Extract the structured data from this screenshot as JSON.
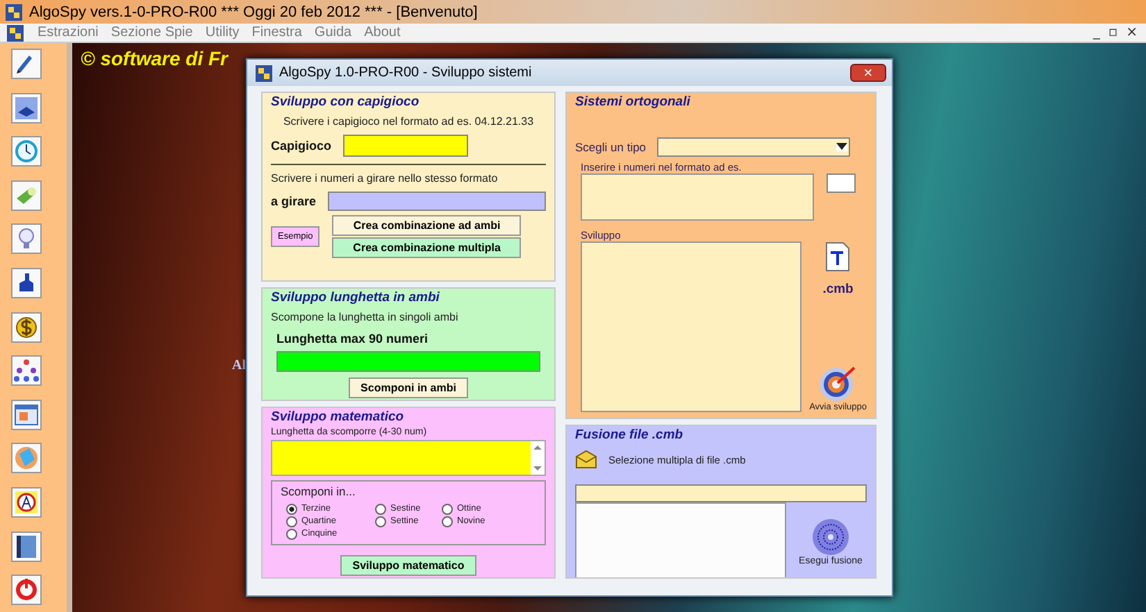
{
  "app_title": "AlgoSpy vers.1-0-PRO-R00  ***  Oggi 20 feb 2012  ***   - [Benvenuto]",
  "menu": [
    "Estrazioni",
    "Sezione Spie",
    "Utility",
    "Finestra",
    "Guida",
    "About"
  ],
  "mdi_controls": [
    "_",
    "▫",
    "×"
  ],
  "background_text": "© software di Fr",
  "background_logo_text": "Al",
  "dialog": {
    "title": "AlgoSpy 1.0-PRO-R00 - Sviluppo sistemi",
    "close": "×",
    "capigioco": {
      "legend": "Sviluppo con capigioco",
      "hint": "Scrivere i capigioco nel formato ad es. 04.12.21.33",
      "field_label": "Capigioco",
      "hint2": "Scrivere i numeri a girare nello stesso formato",
      "field2_label": "a girare",
      "example_button": "Esempio",
      "buttons": [
        "Crea combinazione ad ambi",
        "Crea combinazione multipla"
      ]
    },
    "lunghetta": {
      "legend": "Sviluppo lunghetta in ambi",
      "hint": "Scompone la lunghetta in singoli ambi",
      "field_label": "Lunghetta max 90 numeri",
      "button": "Scomponi in ambi"
    },
    "matematico": {
      "legend": "Sviluppo matematico",
      "field_label": "Lunghetta da scomporre (4-30 num)",
      "group_legend": "Scomponi in...",
      "options": [
        {
          "label": "Terzine",
          "selected": true
        },
        {
          "label": "Sestine",
          "selected": false
        },
        {
          "label": "Ottine",
          "selected": false
        },
        {
          "label": "Quartine",
          "selected": false
        },
        {
          "label": "Settine",
          "selected": false
        },
        {
          "label": "Novine",
          "selected": false
        },
        {
          "label": "Cinquine",
          "selected": false
        }
      ],
      "button": "Sviluppo matematico"
    },
    "ortogonali": {
      "legend": "Sistemi ortogonali",
      "type_label": "Scegli un tipo",
      "numbers_label": "Inserire i numeri nel formato ad es.",
      "output_label": "Sviluppo",
      "file_ext": ".cmb",
      "run_label": "Avvia sviluppo"
    },
    "fusione": {
      "legend": "Fusione file .cmb",
      "select_label": "Selezione multipla di file .cmb",
      "run_label": "Esegui fusione"
    }
  }
}
